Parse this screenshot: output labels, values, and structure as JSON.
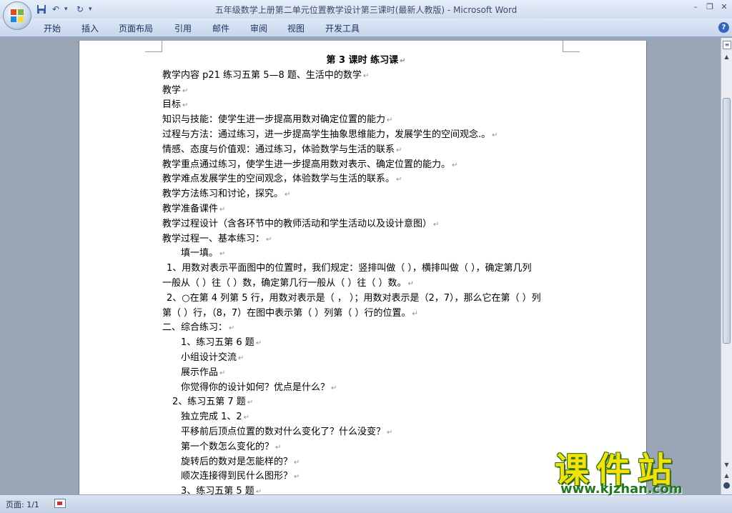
{
  "window": {
    "title": "五年级数学上册第二单元位置教学设计第三课时(最新人教版)  -  Microsoft Word"
  },
  "quick_access": {
    "save_icon": "save-icon",
    "undo_icon": "undo-icon",
    "redo_icon": "redo-icon",
    "customize_icon": "customize-icon"
  },
  "ribbon": {
    "tabs": [
      "开始",
      "插入",
      "页面布局",
      "引用",
      "邮件",
      "审阅",
      "视图",
      "开发工具"
    ]
  },
  "document": {
    "title": "第 3 课时  练习课",
    "lines": [
      "教学内容 p21 练习五第 5—8 题、生活中的数学",
      "教学",
      "目标",
      "知识与技能：使学生进一步提高用数对确定位置的能力",
      "过程与方法：通过练习，进一步提高学生抽象思维能力，发展学生的空间观念.。",
      "情感、态度与价值观：通过练习，体验数学与生活的联系",
      "教学重点通过练习，使学生进一步提高用数对表示、确定位置的能力。",
      "教学难点发展学生的空间观念，体验数学与生活的联系。",
      "教学方法练习和讨论，探究。",
      "教学准备课件",
      "教学过程设计（含各环节中的教师活动和学生活动以及设计意图）",
      "教学过程一、基本练习：",
      "    填一填。",
      " 1、用数对表示平面图中的位置时，我们规定：竖排叫做（ ），横排叫做（ ），确定第几列",
      "一般从（ ）往（ ）数，确定第几行一般从（ ）往（ ）数。",
      " 2、○在第 4 列第 5 行，用数对表示是（ ，  ）；用数对表示是（2，7），那么它在第（ ）列",
      "第（ ）行，（8，7）在图中表示第（ ）列第（ ）行的位置。",
      "二、综合练习：",
      "    1、练习五第 6 题",
      "    小组设计交流",
      "    展示作品",
      "    你觉得你的设计如何？优点是什么？",
      "   2、练习五第 7 题",
      "    独立完成 1、2",
      "    平移前后顶点位置的数对什么变化了？什么没变？",
      "    第一个数怎么变化的？",
      "    旋转后的数对是怎能样的？",
      "    顺次连接得到民什么图形？",
      "    3、练习五第 5 题"
    ]
  },
  "status": {
    "page": "页面: 1/1"
  },
  "watermark": {
    "name": "课件站",
    "url": "www.kjzhan.com"
  }
}
